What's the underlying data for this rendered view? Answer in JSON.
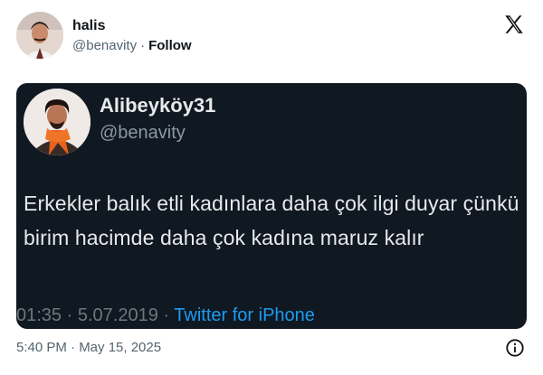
{
  "header": {
    "display_name": "halis",
    "handle": "@benavity",
    "separator": "·",
    "follow_label": "Follow"
  },
  "embedded_tweet": {
    "display_name": "Alibeyköy31",
    "handle": "@benavity",
    "text": "Erkekler balık etli kadınlara daha çok ilgi duyar çünkü birim hacimde daha çok kadına maruz kalır",
    "time": "01:35",
    "date": "5.07.2019",
    "separator1": "·",
    "separator2": "·",
    "source": "Twitter for iPhone"
  },
  "footer": {
    "timestamp": "5:40 PM · May 15, 2025"
  },
  "icons": {
    "logo": "x-logo-icon",
    "info": "info-icon"
  },
  "colors": {
    "embed_background": "#101822",
    "embed_text": "#e7e9ea",
    "embed_meta": "#71767b",
    "link_blue": "#1d9bf0",
    "muted": "#536471"
  }
}
